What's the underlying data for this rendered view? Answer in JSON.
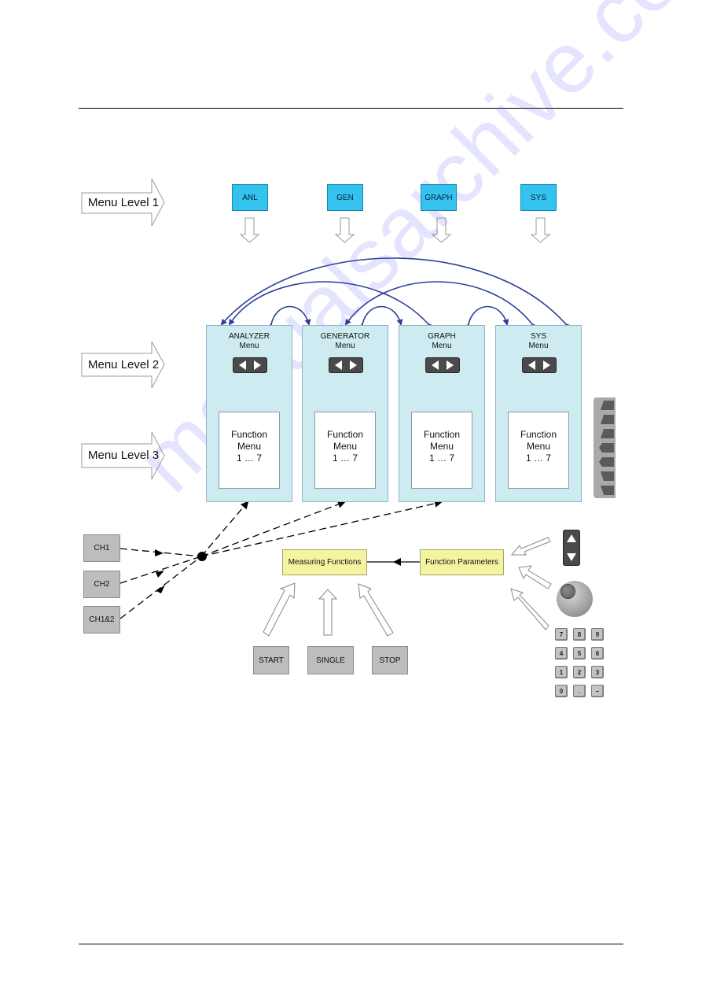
{
  "diagram": {
    "levels": [
      {
        "label": "Menu Level 1"
      },
      {
        "label": "Menu Level 2"
      },
      {
        "label": "Menu Level 3"
      }
    ],
    "level1_buttons": [
      {
        "label": "ANL"
      },
      {
        "label": "GEN"
      },
      {
        "label": "GRAPH"
      },
      {
        "label": "SYS"
      }
    ],
    "menus": [
      {
        "title": "ANALYZER",
        "subtitle": "Menu",
        "function_line1": "Function",
        "function_line2": "Menu",
        "function_line3": "1 … 7"
      },
      {
        "title": "GENERATOR",
        "subtitle": "Menu",
        "function_line1": "Function",
        "function_line2": "Menu",
        "function_line3": "1 … 7"
      },
      {
        "title": "GRAPH",
        "subtitle": "Menu",
        "function_line1": "Function",
        "function_line2": "Menu",
        "function_line3": "1 … 7"
      },
      {
        "title": "SYS",
        "subtitle": "Menu",
        "function_line1": "Function",
        "function_line2": "Menu",
        "function_line3": "1 … 7"
      }
    ],
    "channels": [
      {
        "label": "CH1"
      },
      {
        "label": "CH2"
      },
      {
        "label": "CH1&2"
      }
    ],
    "measuring_functions": "Measuring Functions",
    "function_parameters": "Function Parameters",
    "control_buttons": [
      {
        "label": "START"
      },
      {
        "label": "SINGLE"
      },
      {
        "label": "STOP"
      }
    ],
    "keypad": [
      "7",
      "8",
      "9",
      "4",
      "5",
      "6",
      "1",
      "2",
      "3",
      "0",
      ".",
      "–"
    ],
    "colors": {
      "level1_button": "#33c3ee",
      "menu_panel": "#cdebf1",
      "yellow_box": "#f3f3a0",
      "grey_button": "#bdbdbd",
      "arc_blue": "#2e3f99"
    },
    "icons": {
      "nav_key": "left-right-arrow-keys",
      "updown_key": "up-down-arrow-keys",
      "rotary_knob": "rotary-knob",
      "softkeys": "softkey-strip"
    }
  },
  "watermark": "manualsarchive.com"
}
